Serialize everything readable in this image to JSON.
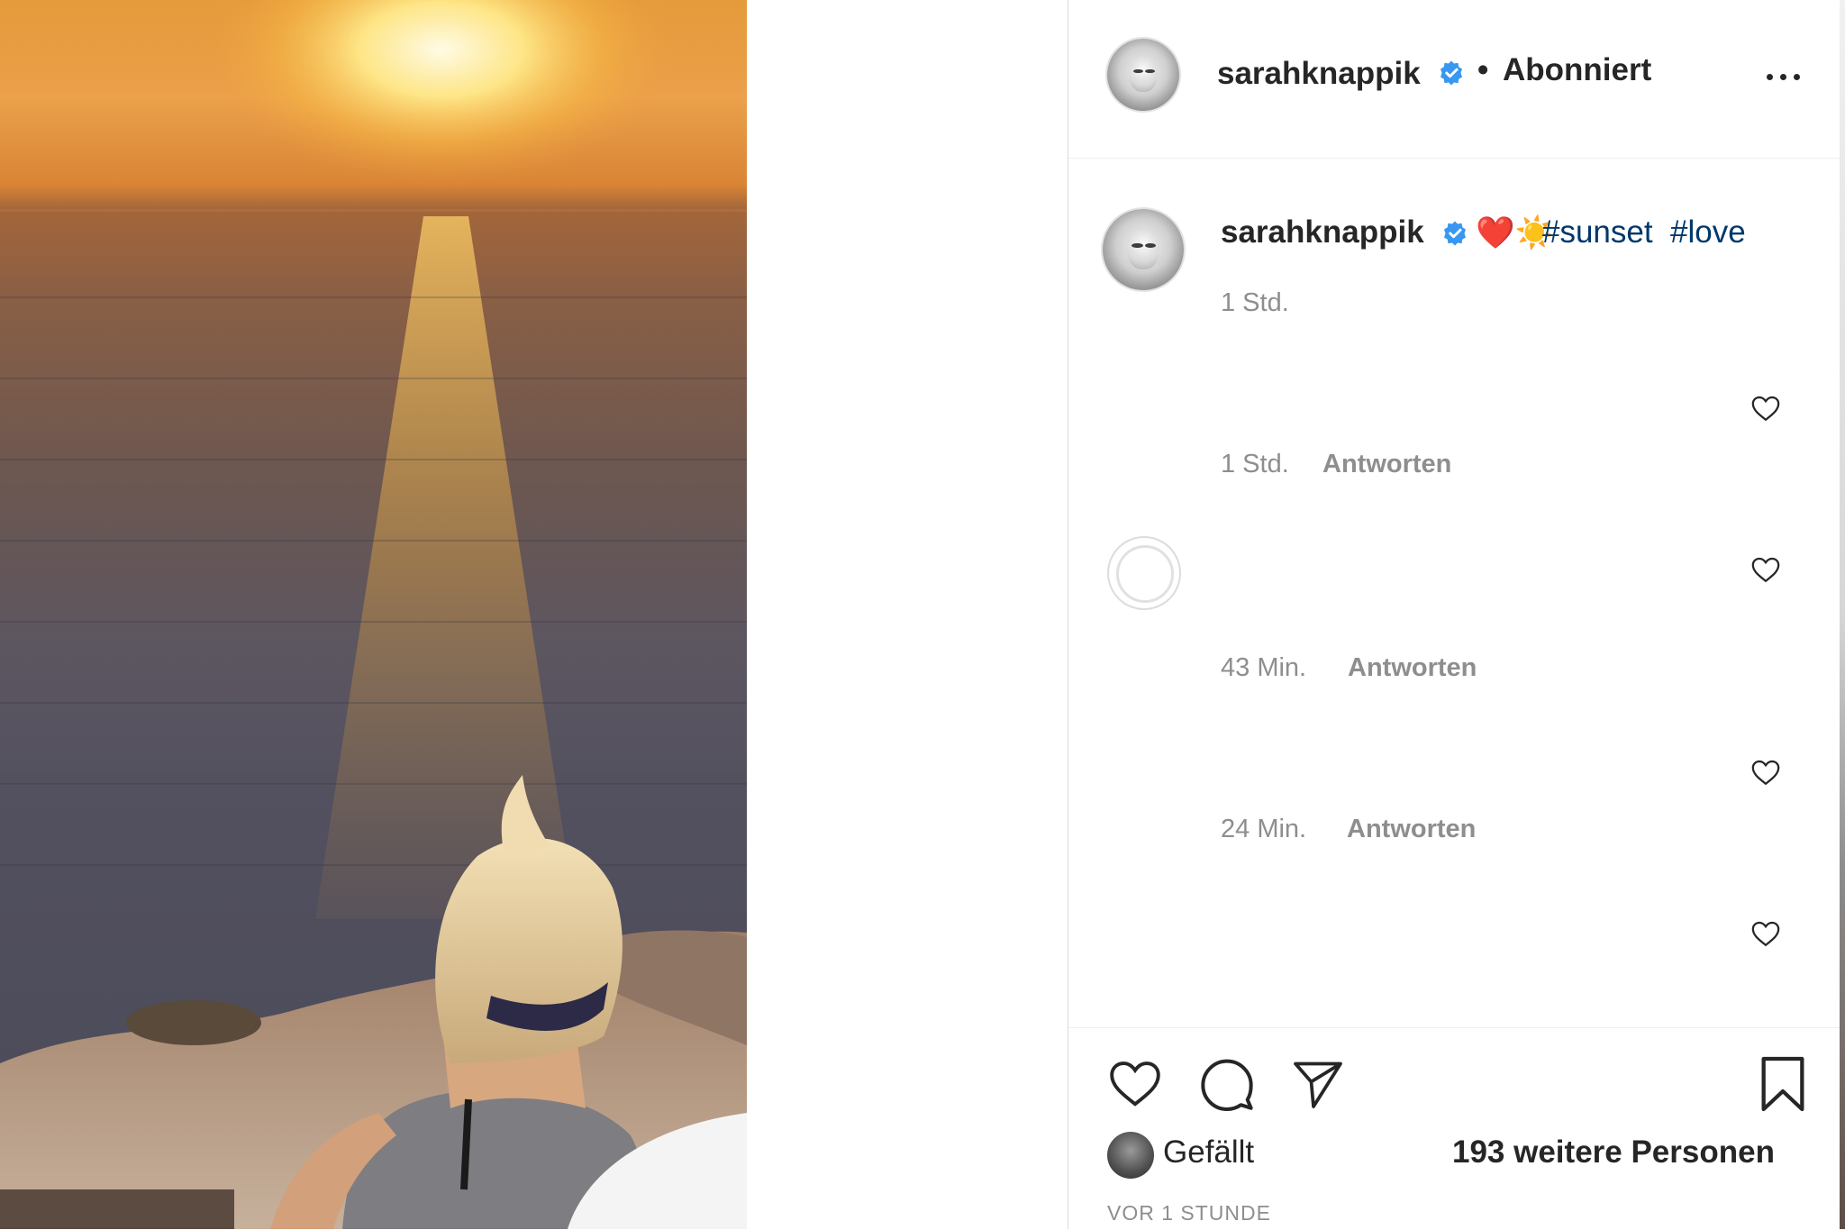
{
  "header": {
    "username": "sarahknappik",
    "separator": "•",
    "follow_status": "Abonniert"
  },
  "caption": {
    "username": "sarahknappik",
    "emojis": "❤️☀️",
    "hashtag1": "#sunset",
    "hashtag2": "#love",
    "time": "1 Std."
  },
  "comments": [
    {
      "time": "1 Std.",
      "reply_label": "Antworten"
    },
    {
      "time": "43 Min.",
      "reply_label": "Antworten"
    },
    {
      "time": "24 Min.",
      "reply_label": "Antworten"
    }
  ],
  "likes": {
    "prefix": "Gefällt",
    "others": "193 weitere Personen"
  },
  "post_time": "VOR 1 STUNDE",
  "colors": {
    "hashtag": "#00376b",
    "verified": "#3897f0",
    "heart": "#ed4956"
  }
}
